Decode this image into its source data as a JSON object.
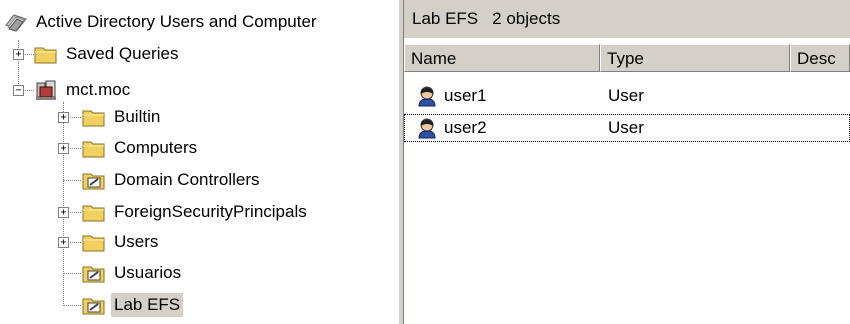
{
  "tree": {
    "root": "Active Directory Users and Computer",
    "saved_queries": "Saved Queries",
    "domain": "mct.moc",
    "children": [
      "Builtin",
      "Computers",
      "Domain Controllers",
      "ForeignSecurityPrincipals",
      "Users",
      "Usuarios",
      "Lab EFS"
    ],
    "selected": "Lab EFS"
  },
  "right_pane": {
    "container": "Lab EFS",
    "count": "2 objects",
    "columns": [
      "Name",
      "Type",
      "Desc"
    ],
    "rows": [
      {
        "name": "user1",
        "type": "User"
      },
      {
        "name": "user2",
        "type": "User"
      }
    ]
  },
  "icons": {
    "root": "ad-snapin-icon",
    "folder": "folder-icon",
    "domain": "domain-icon",
    "ou": "organizational-unit-icon",
    "user": "user-icon"
  },
  "colors": {
    "folder": "#f0d060",
    "chrome": "#d4d0c8",
    "selection": "#d4d0c8"
  }
}
